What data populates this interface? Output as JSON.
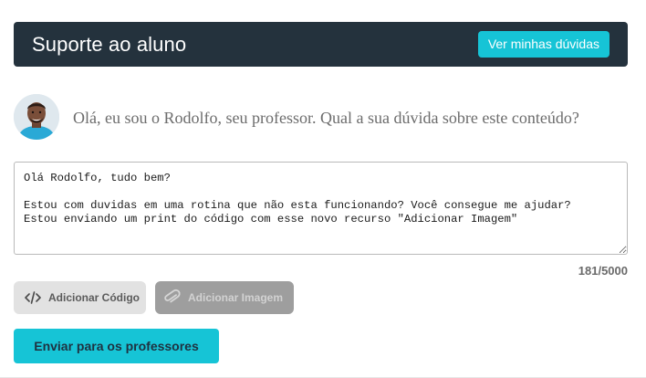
{
  "header": {
    "title": "Suporte ao aluno",
    "view_questions_label": "Ver minhas dúvidas"
  },
  "intro": {
    "avatar": "teacher-avatar",
    "greeting": "Olá, eu sou o Rodolfo, seu professor. Qual a sua dúvida sobre este conteúdo?"
  },
  "message": {
    "value": "Olá Rodolfo, tudo bem?\n\nEstou com duvidas em uma rotina que não esta funcionando? Você consegue me ajudar?\nEstou enviando um print do código com esse novo recurso \"Adicionar Imagem\"",
    "counter": "181/5000"
  },
  "actions": {
    "add_code_label": "Adicionar Código",
    "add_code_icon": "code-icon",
    "add_image_label": "Adicionar Imagem",
    "add_image_icon": "paperclip-icon",
    "send_label": "Enviar para os professores"
  },
  "colors": {
    "header_bg": "#24323d",
    "accent": "#16c4d6",
    "disabled_button": "#9e9e9e",
    "secondary_button": "#e2e2e2"
  }
}
